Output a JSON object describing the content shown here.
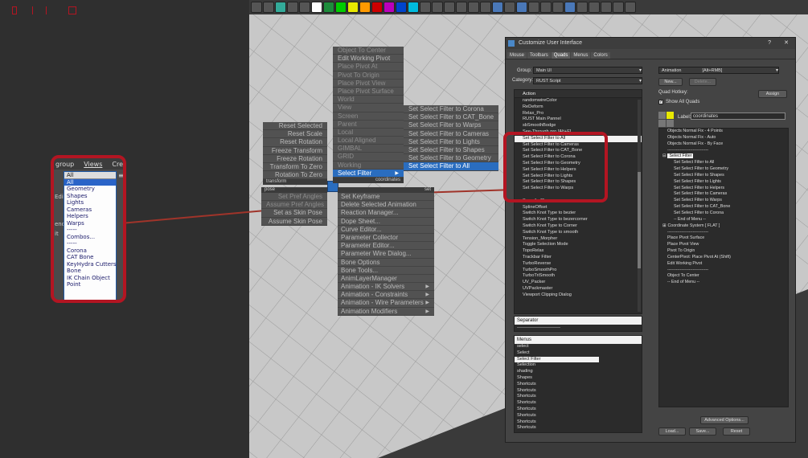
{
  "colors": {
    "highlight_red": "#b31522",
    "menu_blue": "#2a6dbf",
    "window_bg": "#444444"
  },
  "mini": {
    "menus": [
      "group",
      "Views",
      "Cre"
    ],
    "combo": "All",
    "side_labels": [
      "Edi",
      "end",
      "it"
    ],
    "options": [
      "All",
      "Geometry",
      "Shapes",
      "Lights",
      "Cameras",
      "Helpers",
      "Warps",
      "-----",
      "Combos...",
      "-----",
      "Corona",
      "CAT Bone",
      "KeyHydra Cutters",
      "Bone",
      "IK Chain Object",
      "Point"
    ]
  },
  "quad": {
    "left_top": [
      "Reset Selected",
      "Reset Scale",
      "Reset Rotation",
      "Freeze Transform",
      "Freeze Rotation",
      "Transform To Zero",
      "Rotation To Zero"
    ],
    "left_top_header": "transform",
    "left_bottom_header": "pose",
    "left_bottom": [
      "Set Pref Angles",
      "Assume Pref Angles",
      "Set as Skin Pose",
      "Assume Skin Pose"
    ],
    "right_top": [
      "Object To Center",
      "Edit Working Pivot",
      "Place Pivot At",
      "Pivot To Origin",
      "Place Pivot View",
      "Place Pivot Surface",
      "World",
      "View",
      "Screen",
      "Parent",
      "Local",
      "Local Aligned",
      "GIMBAL",
      "GRID",
      "Working",
      "Select Filter"
    ],
    "right_top_header": "coordinates",
    "right_bottom_header": "set",
    "right_bottom": [
      "Set Keyframe",
      "Delete Selected Animation",
      "Reaction Manager...",
      "Dope Sheet...",
      "Curve Editor...",
      "Parameter Collector",
      "Parameter Editor...",
      "Parameter Wire Dialog...",
      "Bone Options",
      "Bone Tools...",
      "AnimLayerManager",
      "Animation - IK Solvers",
      "Animation - Constraints",
      "Animation - Wire Parameters",
      "Animation Modifiers"
    ],
    "submenu": [
      "Set Select Filter to Corona",
      "Set Select Filter to CAT_Bone",
      "Set Select Filter to Warps",
      "Set Select Filter to Cameras",
      "Set Select Filter to Lights",
      "Set Select Filter to Shapes",
      "Set Select Filter to Geometry",
      "Set Select Filter to All"
    ]
  },
  "dialog": {
    "title": "Customize User Interface",
    "tabs": [
      "Mouse",
      "Toolbars",
      "Quads",
      "Menus",
      "Colors"
    ],
    "group_label": "Group:",
    "group_value": "Main UI",
    "category_label": "Category:",
    "category_value": "RUST Script",
    "action_header": "Action",
    "actions": [
      "randomwireColor",
      "ReDeform",
      "Relax_Pro",
      "RUST Main Pannel",
      "sbSmoothBodge",
      "See-Through pro [Alt+F]",
      "Set Select Filter to All",
      "Set Select Filter to Cameras",
      "Set Select Filter to CAT_Bone",
      "Set Select Filter to Corona",
      "Set Select Filter to Geometry",
      "Set Select Filter to Helpers",
      "Set Select Filter to Lights",
      "Set Select Filter to Shapes",
      "Set Select Filter to Warps",
      "Smooth-45",
      "SplineOffset",
      "Switch Knot Type to bezier",
      "Switch Knot Type to bezercorner",
      "Switch Knot Type to Corner",
      "Switch Knot Type to smooth",
      "Tension_Morpher",
      "Toggle Selection Mode",
      "TopoRelax",
      "Trackbar Filter",
      "TurboReverse",
      "TurboSmoothPro",
      "TurboTriSmooth",
      "UV_Packer",
      "UVPackmaster",
      "Viewport Clipping Dialog"
    ],
    "separator_header": "Separator",
    "separator_line": "---------------------------",
    "menus_header": "Menus",
    "menus": [
      "select",
      "Select",
      "Select Filter",
      "Selection",
      "shading",
      "Shapes",
      "Shortcuts",
      "Shortcuts",
      "Shortcuts",
      "Shortcuts",
      "Shortcuts",
      "Shortcuts",
      "Shortcuts",
      "Shortcuts"
    ],
    "quad_dropdown": "Animation",
    "quad_hotkey_display": "[Alt+RMB]",
    "new_btn": "New...",
    "delete_btn": "Delete...",
    "quad_hotkey_label": "Quad Hotkey:",
    "assign_btn": "Assign",
    "show_all": "Show All Quads",
    "label_label": "Label:",
    "label_value": "coordinates",
    "tree": [
      "Objects Normal Fix - 4 Points",
      "Objects Normal Fix - Auto",
      "Objects Normal Fix - By Face",
      "-----------------------------",
      "Select Filter",
      "Set Select Filter to All",
      "Set Select Filter to Geometry",
      "Set Select Filter to Shapes",
      "Set Select Filter to Lights",
      "Set Select Filter to Helpers",
      "Set Select Filter to Cameras",
      "Set Select Filter to Warps",
      "Set Select Filter to CAT_Bone",
      "Set Select Filter to Corona",
      "-- End of Menu --",
      "Coordinate System [ FLAT ]",
      "-----------------------------",
      "Place Pivot Surface",
      "Place Pivot View",
      "Pivot To Origin",
      "CenterPivot: Place Pivot At (Shift)",
      "Edit Working Pivot",
      "-----------------------------",
      "Object To Center",
      "-- End of Menu --"
    ],
    "advanced_btn": "Advanced Options...",
    "load_btn": "Load...",
    "save_btn": "Save...",
    "reset_btn": "Reset",
    "help": "?",
    "close": "✕"
  }
}
